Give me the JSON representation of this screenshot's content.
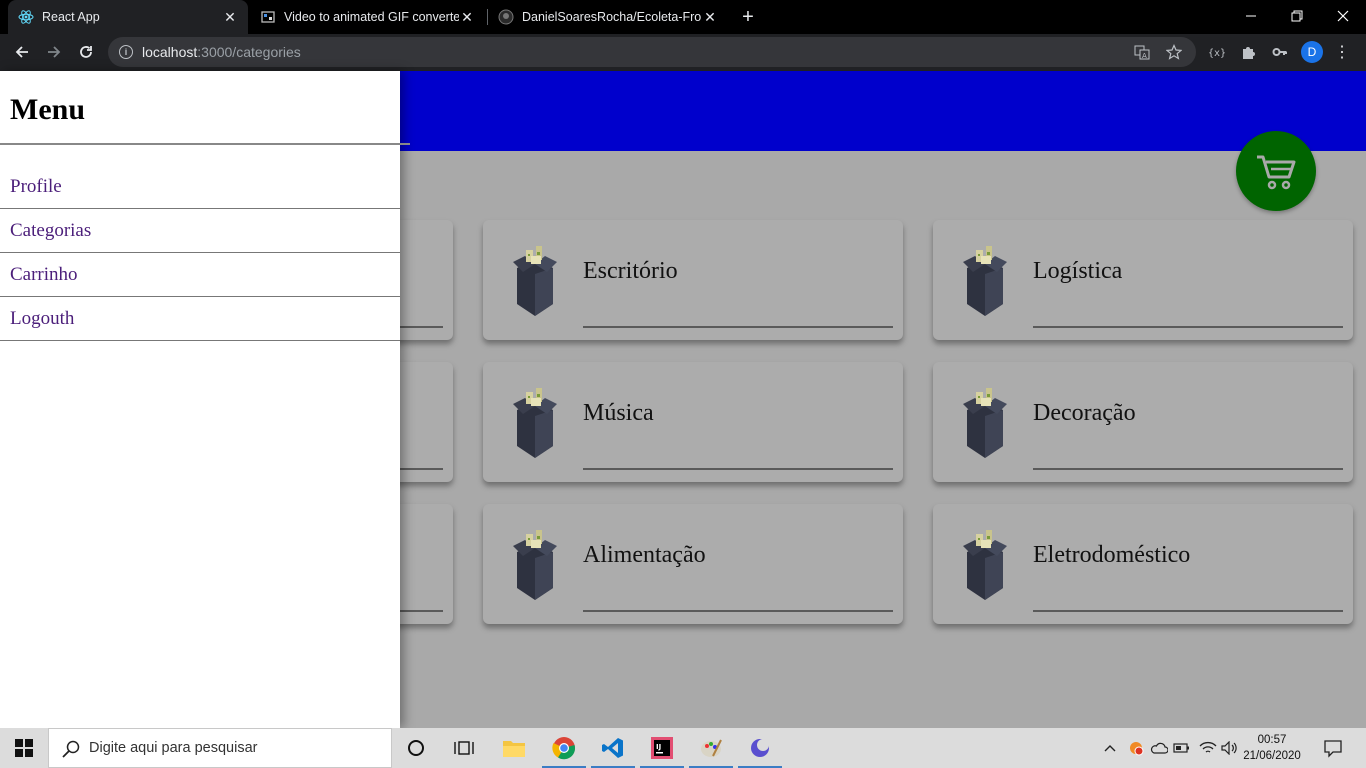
{
  "browser": {
    "tabs": [
      {
        "title": "React App",
        "active": true,
        "icon": "react-icon"
      },
      {
        "title": "Video to animated GIF converter",
        "active": false,
        "icon": "ezgif-icon"
      },
      {
        "title": "DanielSoaresRocha/Ecoleta-Front",
        "active": false,
        "icon": "github-icon"
      }
    ],
    "new_tab": "+",
    "url_host": "localhost",
    "url_path": ":3000/categories",
    "profile_initial": "D"
  },
  "drawer": {
    "title": "Menu",
    "items": [
      "Profile",
      "Categorias",
      "Carrinho",
      "Logouth"
    ]
  },
  "categories": [
    {
      "label": "",
      "visible_label": false
    },
    {
      "label": "Escritório"
    },
    {
      "label": "Logística"
    },
    {
      "label": "",
      "visible_label": false
    },
    {
      "label": "Música"
    },
    {
      "label": "Decoração"
    },
    {
      "label": "",
      "visible_label": false
    },
    {
      "label": "Alimentação"
    },
    {
      "label": "Eletrodoméstico"
    }
  ],
  "colors": {
    "header": "#0000cc",
    "cart_button": "#006400",
    "page_background": "#a9a9a9",
    "menu_link": "#4b1e7a"
  },
  "taskbar": {
    "search_placeholder": "Digite aqui para pesquisar",
    "time": "00:57",
    "date": "21/06/2020"
  }
}
